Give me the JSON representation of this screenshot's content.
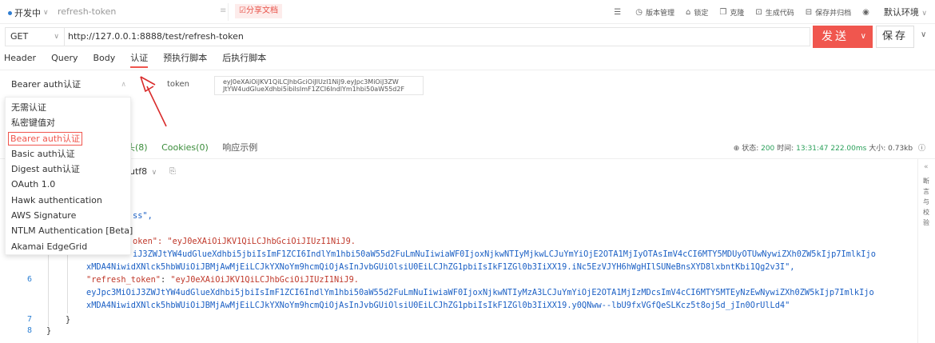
{
  "topbar": {
    "status": "开发中",
    "name_value": "refresh-token",
    "share_label": "分享文档",
    "tools": [
      {
        "icon": "list-icon",
        "glyph": "☰",
        "label": ""
      },
      {
        "icon": "clock-icon",
        "glyph": "◷",
        "label": "版本管理"
      },
      {
        "icon": "lock-icon",
        "glyph": "🔒",
        "label": "锁定"
      },
      {
        "icon": "clone-icon",
        "glyph": "❐",
        "label": "克隆"
      },
      {
        "icon": "code-icon",
        "glyph": "⊡",
        "label": "生成代码"
      },
      {
        "icon": "archive-icon",
        "glyph": "⊟",
        "label": "保存并归档"
      },
      {
        "icon": "eye-icon",
        "glyph": "◉",
        "label": ""
      }
    ],
    "environment": "默认环境"
  },
  "request": {
    "method": "GET",
    "url": "http://127.0.0.1:8888/test/refresh-token",
    "send_label": "发送",
    "save_label": "保存"
  },
  "tabs": [
    "Header",
    "Query",
    "Body",
    "认证",
    "预执行脚本",
    "后执行脚本"
  ],
  "active_tab": "认证",
  "auth": {
    "selected": "Bearer auth认证",
    "token_label": "token",
    "token_line1": "eyJ0eXAiOiJKV1QiLCJhbGciOiJIUzI1NiJ9.eyJpc3MiOiJ3ZW",
    "token_line2": "JtYW4udGlueXdhbi5ibilsImF1ZCI6IndlYm1hbi50aW55d2F",
    "options": [
      "无需认证",
      "私密键值对",
      "Bearer auth认证",
      "Basic auth认证",
      "Digest auth认证",
      "OAuth 1.0",
      "Hawk authentication",
      "AWS Signature",
      "NTLM Authentication [Beta]",
      "Akamai EdgeGrid"
    ]
  },
  "response": {
    "tab_headers_suffix": "头(8)",
    "tab_cookies": "Cookies(0)",
    "tab_example": "响应示例",
    "status_label": "状态:",
    "status_value": "200",
    "time_label": "时间:",
    "time_value": "13:31:47",
    "duration": "222.00ms",
    "size_label": "大小:",
    "size_value": "0.73kb",
    "encoding": "utf8",
    "side_label": "断言与校验",
    "code": {
      "line_success": "ss\",",
      "line_token_key": "oken\": ",
      "line_token_val1": "\"eyJ0eXAiOiJKV1QiLCJhbGciOiJIUzI1NiJ9.",
      "line_token_val2_prefix": "iJ3ZWJtYW4udGlueXdhbi5jbiIsImF1ZCI6IndlYm1hbi50aW55d2FuLmNuIiwiaWF0IjoxNjkwNTIyMjkwLCJuYmYiOjE2OTA1MjIyOTAsImV4cCI6MTY5MDUyOTUwNywiZXh0ZW5kIjp7ImlkIjo",
      "line_token_val3": "xMDA4NiwidXNlck5hbWUiOiJBMjAwMjEiLCJkYXNoYm9hcmQiOjAsInJvbGUiOlsiU0EiLCJhZG1pbiIsIkF1ZGl0b3IiXX19.iNc5EzVJYH6hWgHIlSUNeBnsXYD8lxbntKbi1Qg2v3I\",",
      "line6_key": "\"refresh_token\"",
      "line6_val1": "\"eyJ0eXAiOiJKV1QiLCJhbGciOiJIUzI1NiJ9.",
      "line6_val2": "eyJpc3MiOiJ3ZWJtYW4udGlueXdhbi5jbiIsImF1ZCI6IndlYm1hbi50aW55d2FuLmNuIiwiaWF0IjoxNjkwNTIyMzA3LCJuYmYiOjE2OTA1MjIzMDcsImV4cCI6MTY5MTEyNzEwNywiZXh0ZW5kIjp7ImlkIjo",
      "line6_val3": "xMDA4NiwidXNlck5hbWUiOiJBMjAwMjEiLCJkYXNoYm9hcmQiOjAsInJvbGUiOlsiU0EiLCJhZG1pbiIsIkF1ZGl0b3IiXX19.y0QNww--lbU9fxVGfQeSLKcz5t8oj5d_jIn0OrUlLd4\"",
      "line7": "}",
      "line8": "}",
      "line_numbers": [
        "6",
        "7",
        "8"
      ]
    }
  },
  "colors": {
    "accent": "#f0564e",
    "status_green": "#2aa05a",
    "link_blue": "#1a5fc4"
  }
}
